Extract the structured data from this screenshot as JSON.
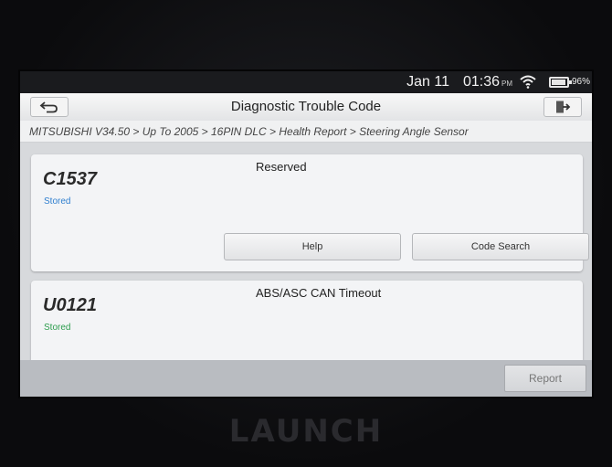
{
  "status_bar": {
    "date": "Jan 11",
    "time": "01:36",
    "ampm": "PM",
    "battery": "96%",
    "battery_level": 0.96,
    "icons": [
      "wifi-icon",
      "battery-icon"
    ]
  },
  "header": {
    "title": "Diagnostic Trouble Code",
    "back_icon": "back-arrow-icon",
    "exit_icon": "exit-icon"
  },
  "breadcrumb": "MITSUBISHI V34.50 > Up To 2005 > 16PIN DLC > Health Report > Steering Angle Sensor",
  "dtc_list": [
    {
      "code": "C1537",
      "status": "Stored",
      "status_color": "#2f7fcf",
      "description": "Reserved",
      "buttons": [
        "Help",
        "Code Search"
      ]
    },
    {
      "code": "U0121",
      "status": "Stored",
      "status_color": "#2e9e4f",
      "description": "ABS/ASC CAN Timeout"
    }
  ],
  "footer": {
    "report_label": "Report"
  },
  "device": {
    "brand": "LAUNCH"
  }
}
